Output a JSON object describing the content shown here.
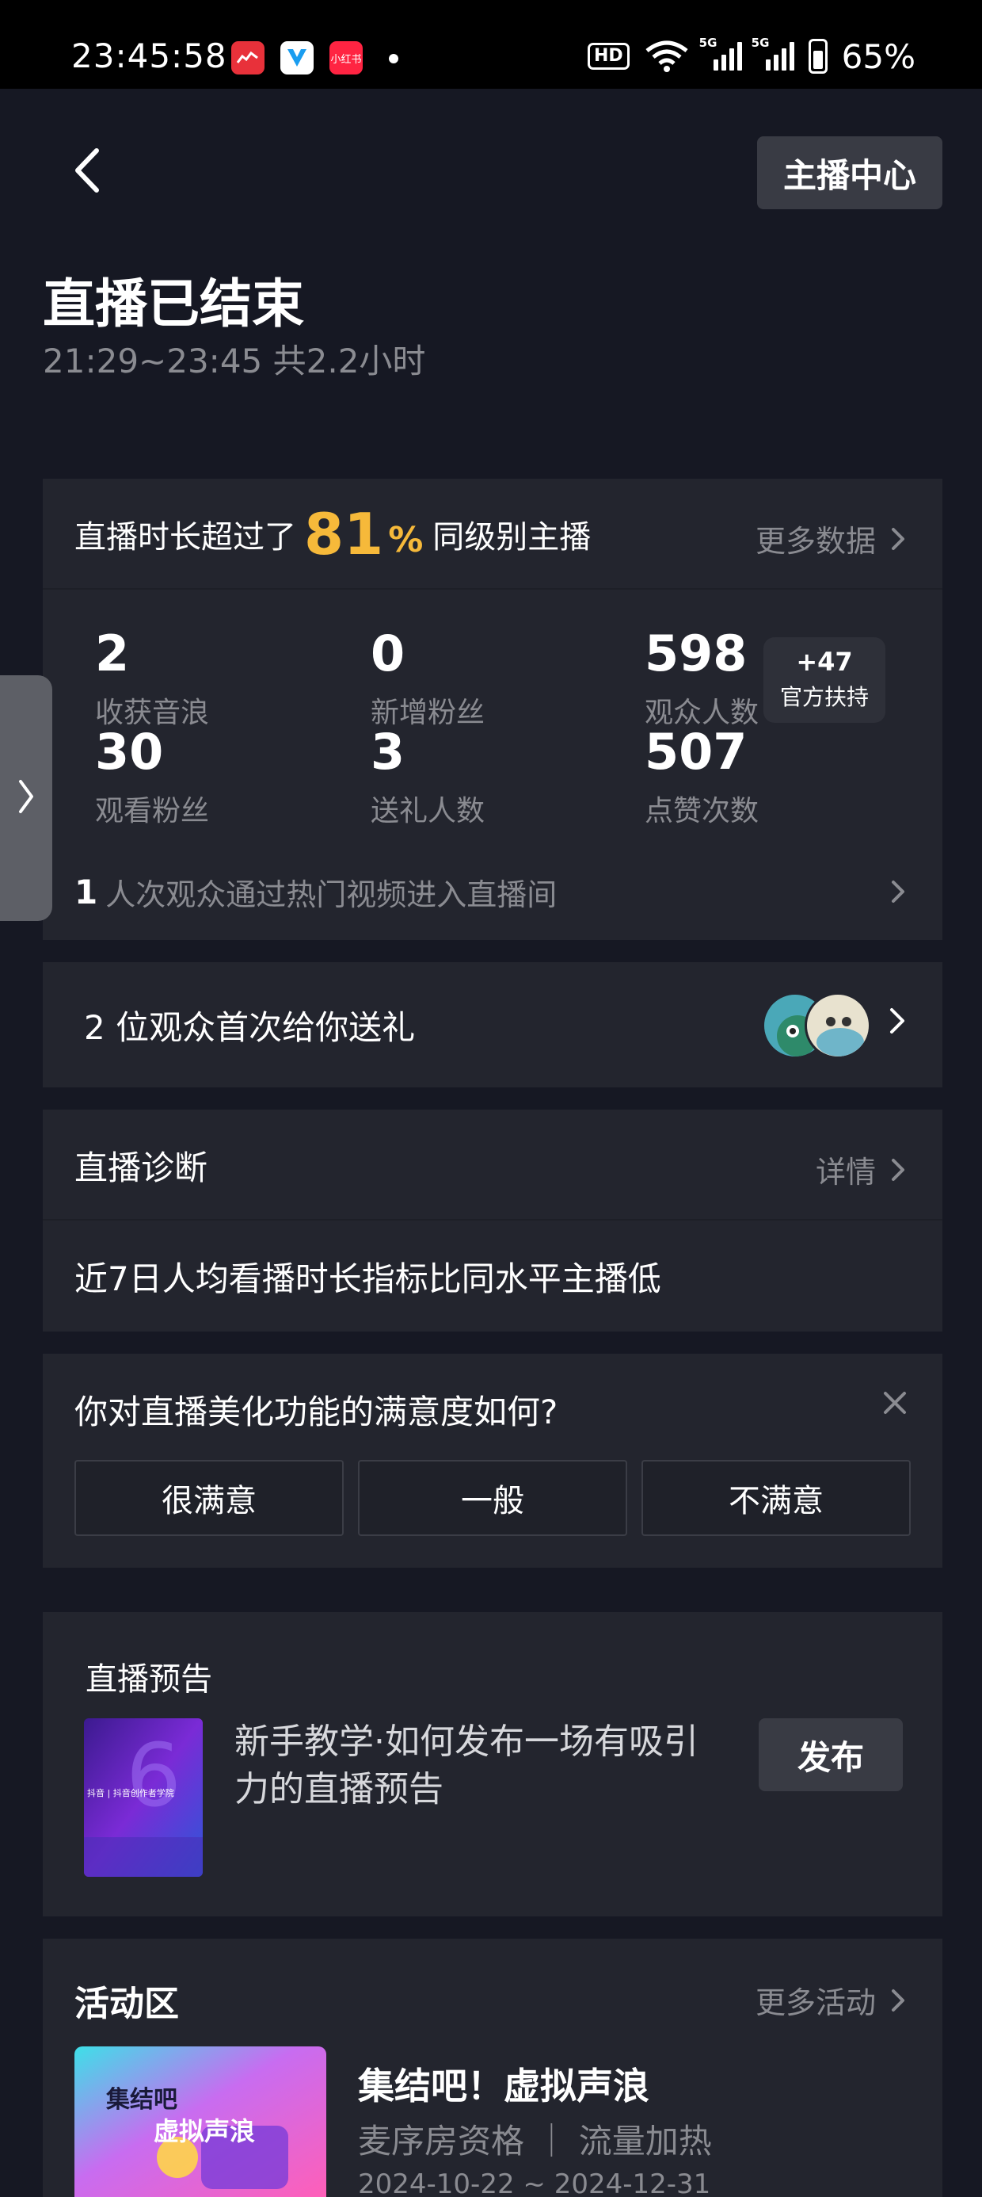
{
  "status_bar": {
    "time": "23:45:58",
    "apps": [
      "app-red-icon",
      "app-blue-icon",
      "小红书"
    ],
    "hd": "HD",
    "sig1": "5G",
    "sig2": "5G",
    "battery": "65%"
  },
  "header": {
    "anchor_center": "主播中心"
  },
  "title": "直播已结束",
  "subtitle": "21:29~23:45 共2.2小时",
  "rank": {
    "prefix": "直播时长超过了",
    "value": "81",
    "unit": "%",
    "suffix": "同级别主播",
    "more": "更多数据"
  },
  "stats": [
    {
      "value": "2",
      "label": "收获音浪"
    },
    {
      "value": "0",
      "label": "新增粉丝"
    },
    {
      "value": "598",
      "label": "观众人数"
    },
    {
      "value": "30",
      "label": "观看粉丝"
    },
    {
      "value": "3",
      "label": "送礼人数"
    },
    {
      "value": "507",
      "label": "点赞次数"
    }
  ],
  "badge": {
    "top": "+47",
    "bottom": "官方扶持"
  },
  "hot": {
    "count": "1",
    "text": "人次观众通过热门视频进入直播间"
  },
  "gift": {
    "text": "2 位观众首次给你送礼"
  },
  "diagnosis": {
    "title": "直播诊断",
    "detail": "详情",
    "body": "近7日人均看播时长指标比同水平主播低"
  },
  "survey": {
    "question": "你对直播美化功能的满意度如何?",
    "options": [
      "很满意",
      "一般",
      "不满意"
    ]
  },
  "preview": {
    "title": "直播预告",
    "desc": "新手教学·如何发布一场有吸引力的直播预告",
    "publish": "发布",
    "thumb_caption": "抖音 | 抖音创作者学院"
  },
  "activity": {
    "title": "活动区",
    "more": "更多活动",
    "name": "集结吧！虚拟声浪",
    "tags": "麦序房资格 ｜ 流量加热",
    "dates": "2024-10-22 ~ 2024-12-31",
    "thumb_text1": "集结吧",
    "thumb_text2": "虚拟声浪"
  },
  "colors": {
    "background": "#161823",
    "card": "#23252e",
    "accent": "#f6b93a",
    "muted": "#8a8b91"
  }
}
